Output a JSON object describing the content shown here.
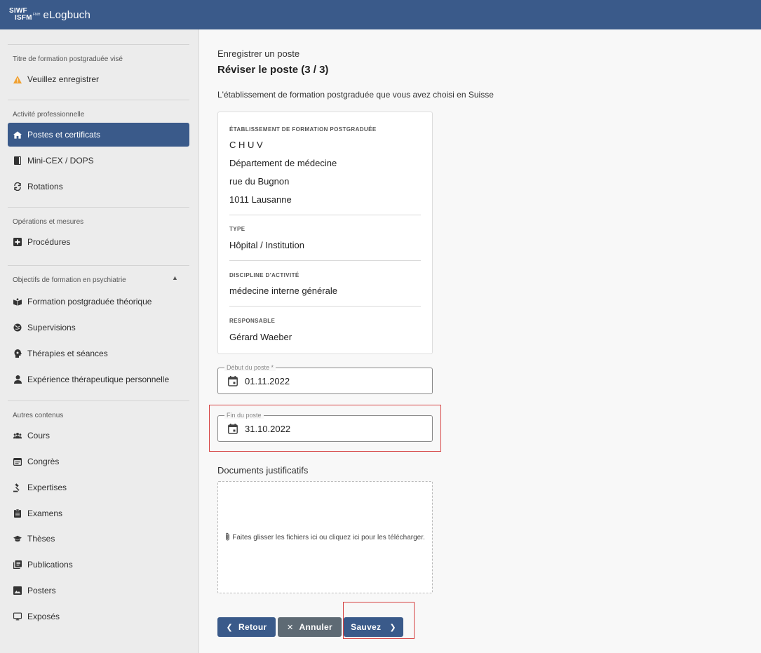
{
  "header": {
    "logo_line1": "SIWF",
    "logo_line2": "ISFM",
    "logo_small": "FMH",
    "app_name": "eLogbuch"
  },
  "sidebar": {
    "section_title": "Titre de formation postgraduée visé",
    "warning_text": "Veuillez enregistrer",
    "section_activity": "Activité professionnelle",
    "nav_postes": "Postes et certificats",
    "nav_minicex": "Mini-CEX / DOPS",
    "nav_rotations": "Rotations",
    "section_operations": "Opérations et mesures",
    "nav_procedures": "Procédures",
    "section_objectives": "Objectifs de formation en psychiatrie",
    "nav_theory": "Formation postgraduée théorique",
    "nav_supervisions": "Supervisions",
    "nav_therapies": "Thérapies et séances",
    "nav_experience": "Expérience thérapeutique personnelle",
    "section_other": "Autres contenus",
    "nav_cours": "Cours",
    "nav_congres": "Congrès",
    "nav_expertises": "Expertises",
    "nav_examens": "Examens",
    "nav_theses": "Thèses",
    "nav_publications": "Publications",
    "nav_posters": "Posters",
    "nav_exposes": "Exposés"
  },
  "main": {
    "subtitle": "Enregistrer un poste",
    "title": "Réviser le poste (3 / 3)",
    "intro": "L'établissement de formation postgraduée que vous avez choisi en Suisse",
    "card": {
      "establishment_label": "Établissement de formation postgraduée",
      "establishment_name": "C H U V",
      "department": "Département de médecine",
      "street": "rue du Bugnon",
      "city": "1011 Lausanne",
      "type_label": "Type",
      "type_value": "Hôpital / Institution",
      "discipline_label": "Discipline d'activité",
      "discipline_value": "médecine interne générale",
      "responsible_label": "Responsable",
      "responsible_value": "Gérard Waeber"
    },
    "start_label": "Début du poste *",
    "start_value": "01.11.2022",
    "end_label": "Fin du poste",
    "end_value": "31.10.2022",
    "docs_label": "Documents justificatifs",
    "dropzone_text": "Faites glisser les fichiers ici ou cliquez ici pour les télécharger.",
    "btn_back": "Retour",
    "btn_cancel": "Annuler",
    "btn_save": "Sauvez"
  },
  "colors": {
    "primary": "#3a5a8a",
    "cancel": "#5e6a74",
    "warning": "#f0a030",
    "highlight": "#d64545"
  }
}
